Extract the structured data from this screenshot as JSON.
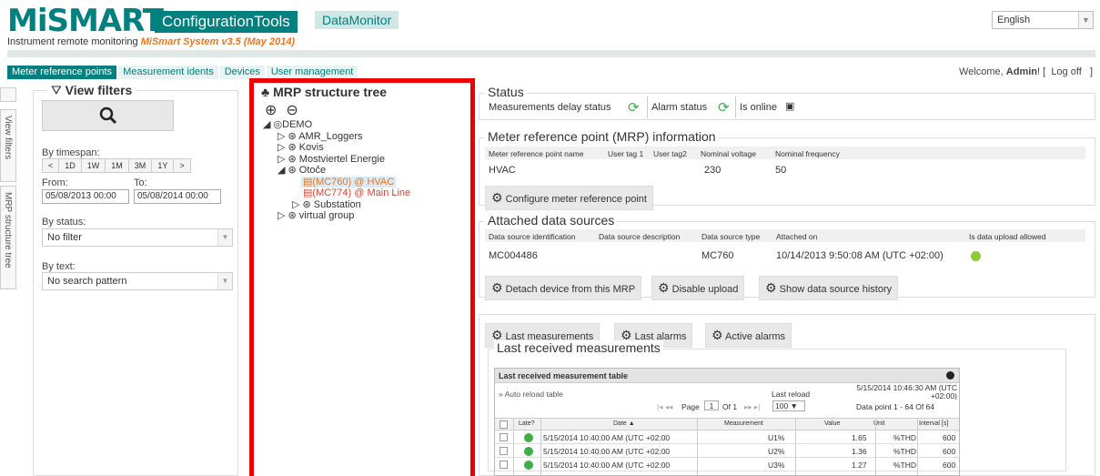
{
  "header": {
    "logo": "MiSMART",
    "tab_config": "ConfigurationTools",
    "tab_datamonitor": "DataMonitor",
    "subtitle_prefix": "Instrument remote monitoring",
    "subtitle_version": "MiSmart System v3.5 (May 2014)",
    "language": "English"
  },
  "nav": {
    "items": [
      "Meter reference points",
      "Measurement idents",
      "Devices",
      "User management"
    ],
    "active": "Meter reference points",
    "welcome_prefix": "Welcome,",
    "welcome_user": "Admin",
    "welcome_suffix": "! [",
    "logoff": "Log off",
    "logoff_close": "]"
  },
  "side_tabs": [
    "View filters",
    "MRP structure tree"
  ],
  "filters": {
    "title": "View filters",
    "timespan_label": "By timespan:",
    "timespan_buttons": [
      "<",
      "1D",
      "1W",
      "1M",
      "3M",
      "1Y",
      ">"
    ],
    "from_label": "From:",
    "to_label": "To:",
    "from_value": "05/08/2013 00:00",
    "to_value": "05/08/2014 00:00",
    "status_label": "By status:",
    "status_value": "No filter",
    "text_label": "By text:",
    "text_value": "No search pattern"
  },
  "tree": {
    "title": "MRP structure tree",
    "nodes": {
      "demo": "DEMO",
      "amr": "AMR_Loggers",
      "kovis": "Kovis",
      "mostviertel": "Mostviertel Energie",
      "otoce": "Otoče",
      "mc760": "(MC760) @ HVAC",
      "mc774": "(MC774) @ Main Line",
      "substation": "Substation",
      "virtual": "virtual group"
    }
  },
  "status": {
    "title": "Status",
    "delay": "Measurements delay status",
    "alarm": "Alarm status",
    "online": "Is online"
  },
  "mrp_info": {
    "title": "Meter reference point (MRP) information",
    "headers": [
      "Meter reference point name",
      "User tag 1",
      "User tag2",
      "Nominal voltage",
      "Nominal frequency"
    ],
    "name": "HVAC",
    "voltage": "230",
    "frequency": "50",
    "configure": "Configure meter reference point"
  },
  "sources": {
    "title": "Attached data sources",
    "headers": [
      "Data source identification",
      "Data source description",
      "Data source type",
      "Attached on",
      "Is data upload allowed"
    ],
    "id": "MC004486",
    "type": "MC760",
    "attached": "10/14/2013 9:50:08 AM (UTC +02:00)",
    "detach": "Detach device from this MRP",
    "disable": "Disable upload",
    "history": "Show data source history"
  },
  "measure": {
    "btn_last": "Last measurements",
    "btn_alarms": "Last alarms",
    "btn_active": "Active alarms",
    "title": "Last received measurements",
    "table_title": "Last received measurement table",
    "auto_reload": "Auto reload table",
    "last_reload_label": "Last reload",
    "last_reload_value": "5/15/2014 10:46:30 AM (UTC +02:00)",
    "page_label": "Page",
    "page_value": "1",
    "of_label": "Of 1",
    "page_size": "100",
    "datapoint": "Data point 1 - 64 Of 64",
    "cols": [
      "Late?",
      "Date",
      "Measurement",
      "Value",
      "Unit",
      "Interval [s]"
    ],
    "rows": [
      {
        "date": "5/15/2014 10:40:00 AM (UTC +02:00",
        "meas": "U1%",
        "value": "1.65",
        "unit": "%THD",
        "interval": "600"
      },
      {
        "date": "5/15/2014 10:40:00 AM (UTC +02:00",
        "meas": "U2%",
        "value": "1.36",
        "unit": "%THD",
        "interval": "600"
      },
      {
        "date": "5/15/2014 10:40:00 AM (UTC +02:00",
        "meas": "U3%",
        "value": "1.27",
        "unit": "%THD",
        "interval": "600"
      }
    ]
  }
}
